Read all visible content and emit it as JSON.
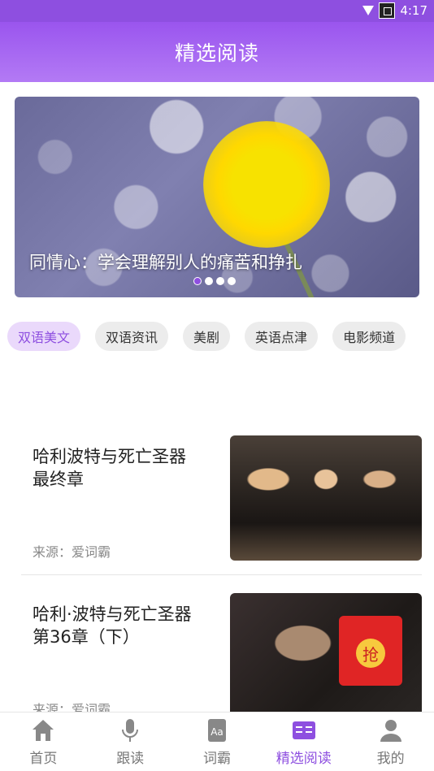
{
  "status_bar": {
    "time": "4:17"
  },
  "header": {
    "title": "精选阅读"
  },
  "banner": {
    "caption": "同情心：学会理解别人的痛苦和挣扎",
    "page_count": 4,
    "active_page": 1
  },
  "categories": [
    {
      "label": "双语美文",
      "active": true
    },
    {
      "label": "双语资讯",
      "active": false
    },
    {
      "label": "美剧",
      "active": false
    },
    {
      "label": "英语点津",
      "active": false
    },
    {
      "label": "电影频道",
      "active": false
    }
  ],
  "articles": [
    {
      "title": "哈利波特与死亡圣器 最终章",
      "source": "来源：爱词霸"
    },
    {
      "title": "哈利·波特与死亡圣器 第36章（下）",
      "source": "来源：爱词霸"
    }
  ],
  "red_packet": {
    "label": "抢"
  },
  "bottom_nav": [
    {
      "label": "首页",
      "icon": "home-icon",
      "active": false
    },
    {
      "label": "跟读",
      "icon": "microphone-icon",
      "active": false
    },
    {
      "label": "词霸",
      "icon": "dictionary-icon",
      "active": false
    },
    {
      "label": "精选阅读",
      "icon": "reading-icon",
      "active": true
    },
    {
      "label": "我的",
      "icon": "profile-icon",
      "active": false
    }
  ],
  "colors": {
    "accent": "#8e4fe0",
    "chip_active_bg": "#ead9fb",
    "red_packet": "#e02525"
  }
}
